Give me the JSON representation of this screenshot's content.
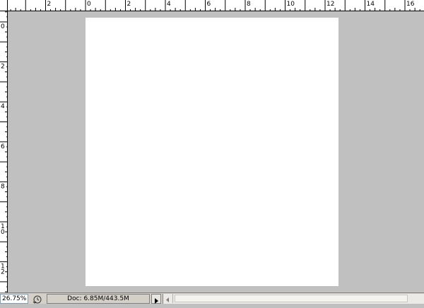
{
  "ruler": {
    "unit": "in",
    "labels": [
      "0",
      "2",
      "4",
      "6",
      "8",
      "10",
      "12",
      "14",
      "16"
    ],
    "h_label_values": [
      -2,
      0,
      2,
      4,
      6,
      8,
      10,
      12,
      14,
      16
    ],
    "v_label_values": [
      0,
      2,
      4,
      6,
      8,
      10,
      12
    ]
  },
  "status": {
    "zoom": "26.75%",
    "doc_info": "Doc: 6.85M/443.5M"
  },
  "colors": {
    "workspace": "#c0c0c0",
    "page": "#ffffff",
    "status_bar": "#d4d0c8"
  },
  "icons": {
    "status_icon": "clock-arrow-icon",
    "menu_arrow": "triangle-right-icon",
    "scroll_left": "triangle-left-icon"
  }
}
